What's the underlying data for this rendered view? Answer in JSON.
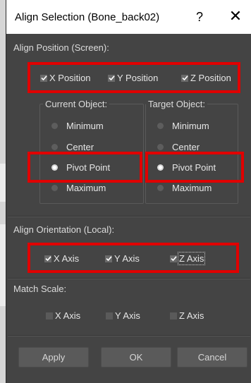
{
  "dialog": {
    "title": "Align Selection (Bone_back02)",
    "help_glyph": "?",
    "close_glyph": "✕"
  },
  "align_position": {
    "label": "Align Position (Screen):",
    "x_label": "X Position",
    "y_label": "Y Position",
    "z_label": "Z Position",
    "x_checked": true,
    "y_checked": true,
    "z_checked": true
  },
  "current_object": {
    "label": "Current Object:",
    "options": [
      "Minimum",
      "Center",
      "Pivot Point",
      "Maximum"
    ],
    "selected": "Pivot Point"
  },
  "target_object": {
    "label": "Target Object:",
    "options": [
      "Minimum",
      "Center",
      "Pivot Point",
      "Maximum"
    ],
    "selected": "Pivot Point"
  },
  "align_orientation": {
    "label": "Align Orientation (Local):",
    "x_label": "X Axis",
    "y_label": "Y Axis",
    "z_label": "Z Axis",
    "x_checked": true,
    "y_checked": true,
    "z_checked": true
  },
  "match_scale": {
    "label": "Match Scale:",
    "x_label": "X Axis",
    "y_label": "Y Axis",
    "z_label": "Z Axis",
    "x_checked": false,
    "y_checked": false,
    "z_checked": false
  },
  "buttons": {
    "apply": "Apply",
    "ok": "OK",
    "cancel": "Cancel"
  },
  "colors": {
    "dialog_bg": "#444444",
    "highlight_red": "#e00000",
    "title_bg": "#ffffff"
  }
}
